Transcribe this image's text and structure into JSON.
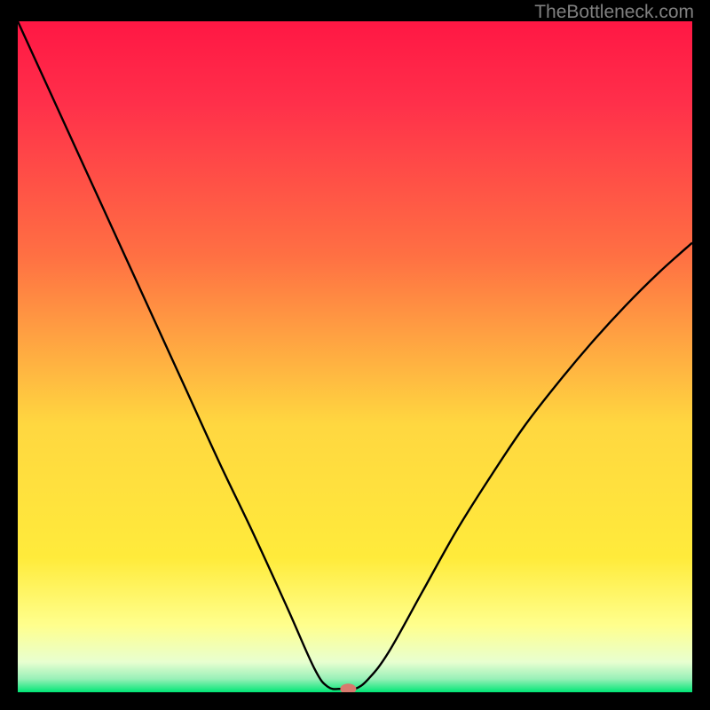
{
  "watermark": "TheBottleneck.com",
  "chart_data": {
    "type": "line",
    "title": "",
    "xlabel": "",
    "ylabel": "",
    "xlim": [
      0,
      100
    ],
    "ylim": [
      0,
      100
    ],
    "gradient_bg": {
      "top": "#ff1744",
      "upper_mid": "#ff7043",
      "mid": "#ffeb3b",
      "lower_mid": "#ffff8d",
      "bottom": "#00e676"
    },
    "marker": {
      "x": 49,
      "y": 0.5,
      "color": "#d87a6e"
    },
    "series": [
      {
        "name": "bottleneck-curve",
        "x": [
          0,
          5,
          10,
          15,
          20,
          25,
          30,
          35,
          40,
          44,
          46,
          48,
          50,
          52,
          55,
          60,
          65,
          70,
          75,
          80,
          85,
          90,
          95,
          100
        ],
        "y": [
          100,
          89,
          78,
          67,
          56,
          45,
          34,
          23.5,
          12.5,
          3.5,
          0.8,
          0.5,
          0.5,
          2,
          6,
          15,
          24,
          32,
          39.5,
          46,
          52,
          57.5,
          62.5,
          67
        ]
      }
    ]
  }
}
